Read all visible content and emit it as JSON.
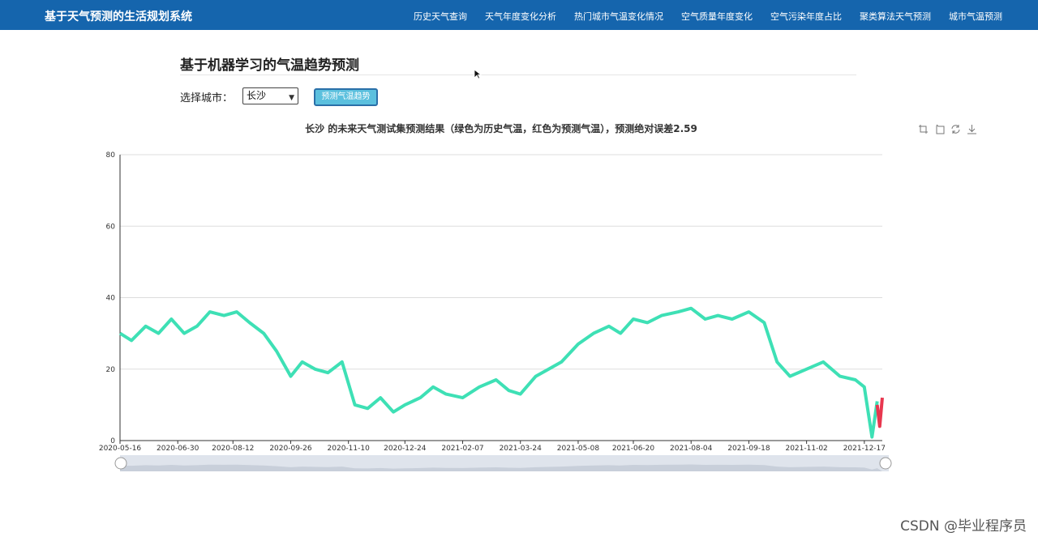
{
  "navbar": {
    "brand": "基于天气预测的生活规划系统",
    "items": [
      "历史天气查询",
      "天气年度变化分析",
      "热门城市气温变化情况",
      "空气质量年度变化",
      "空气污染年度占比",
      "聚类算法天气预测",
      "城市气温预测"
    ]
  },
  "main": {
    "title": "基于机器学习的气温趋势预测",
    "city_label": "选择城市：",
    "city_value": "长沙",
    "predict_button": "预测气温趋势"
  },
  "chart_data": {
    "type": "line",
    "title": "长沙 的未来天气测试集预测结果（绿色为历史气温，红色为预测气温），预测绝对误差2.59",
    "x_tick_labels": [
      "2020-05-16",
      "2020-06-30",
      "2020-08-12",
      "2020-09-26",
      "2020-11-10",
      "2020-12-24",
      "2021-02-07",
      "2021-03-24",
      "2021-05-08",
      "2021-06-20",
      "2021-08-04",
      "2021-09-18",
      "2021-11-02",
      "2021-12-17"
    ],
    "y_ticks": [
      0,
      20,
      40,
      60,
      80
    ],
    "ylim": [
      0,
      80
    ],
    "grid": true,
    "series": [
      {
        "color": "#3ee0b5",
        "x": [
          "2020-05-16",
          "2020-05-25",
          "2020-06-05",
          "2020-06-15",
          "2020-06-25",
          "2020-07-05",
          "2020-07-15",
          "2020-07-25",
          "2020-08-05",
          "2020-08-15",
          "2020-08-25",
          "2020-09-05",
          "2020-09-15",
          "2020-09-26",
          "2020-10-05",
          "2020-10-15",
          "2020-10-25",
          "2020-11-05",
          "2020-11-15",
          "2020-11-25",
          "2020-12-05",
          "2020-12-15",
          "2020-12-24",
          "2021-01-05",
          "2021-01-15",
          "2021-01-25",
          "2021-02-07",
          "2021-02-20",
          "2021-03-05",
          "2021-03-15",
          "2021-03-24",
          "2021-04-05",
          "2021-04-15",
          "2021-04-25",
          "2021-05-08",
          "2021-05-20",
          "2021-06-01",
          "2021-06-10",
          "2021-06-20",
          "2021-07-01",
          "2021-07-12",
          "2021-07-25",
          "2021-08-04",
          "2021-08-15",
          "2021-08-25",
          "2021-09-05",
          "2021-09-18",
          "2021-09-30",
          "2021-10-10",
          "2021-10-20",
          "2021-11-02",
          "2021-11-15",
          "2021-11-28",
          "2021-12-10",
          "2021-12-17",
          "2021-12-23",
          "2021-12-27"
        ],
        "values": [
          30,
          28,
          32,
          30,
          34,
          30,
          32,
          36,
          35,
          36,
          33,
          30,
          25,
          18,
          22,
          20,
          19,
          22,
          10,
          9,
          12,
          8,
          10,
          12,
          15,
          13,
          12,
          15,
          17,
          14,
          13,
          18,
          20,
          22,
          27,
          30,
          32,
          30,
          34,
          33,
          35,
          36,
          37,
          34,
          35,
          34,
          36,
          33,
          22,
          18,
          20,
          22,
          18,
          17,
          15,
          1,
          11
        ]
      },
      {
        "color": "#e8374f",
        "x": [
          "2021-12-27",
          "2021-12-29",
          "2021-12-31"
        ],
        "values": [
          10,
          4,
          12
        ]
      }
    ]
  },
  "toolbox": [
    "zoom-icon",
    "zoom-reset-icon",
    "restore-icon",
    "download-icon"
  ],
  "watermark": "CSDN @毕业程序员"
}
